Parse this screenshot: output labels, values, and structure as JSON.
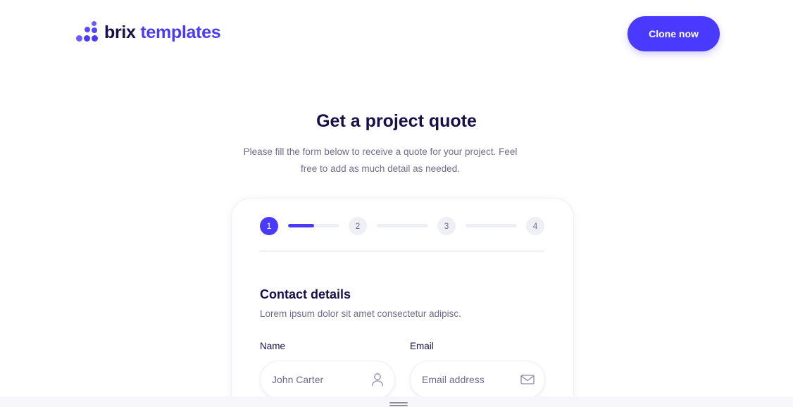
{
  "header": {
    "logo": {
      "word1": "brix",
      "word2": "templates",
      "icon": "brix-dots-logo-icon"
    },
    "clone_button": "Clone now"
  },
  "hero": {
    "title": "Get a project quote",
    "subtitle": "Please fill the form below to receive a quote for your project. Feel free to add as much detail as needed."
  },
  "stepper": {
    "steps": [
      "1",
      "2",
      "3",
      "4"
    ],
    "current_step": 1,
    "current_track_fill": 0.5
  },
  "form": {
    "section_title": "Contact details",
    "section_desc": "Lorem ipsum dolor sit amet consectetur adipisc.",
    "name": {
      "label": "Name",
      "placeholder": "John Carter",
      "icon": "user-icon"
    },
    "email": {
      "label": "Email",
      "placeholder": "Email address",
      "icon": "mail-icon"
    }
  },
  "colors": {
    "accent": "#4a3aff",
    "heading": "#170f49",
    "body": "#6f6c90",
    "light": "#eff0f6"
  }
}
